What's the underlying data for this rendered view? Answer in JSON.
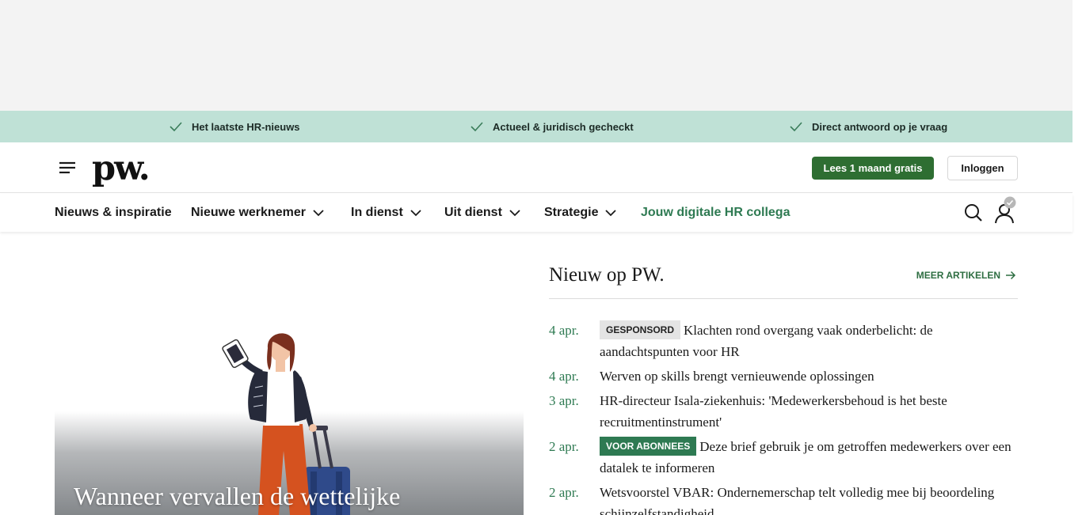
{
  "usps": [
    {
      "label": "Het laatste HR-nieuws"
    },
    {
      "label": "Actueel & juridisch gecheckt"
    },
    {
      "label": "Direct antwoord op je vraag"
    }
  ],
  "header": {
    "logo": "pw.",
    "trial_button": "Lees 1 maand gratis",
    "login_button": "Inloggen"
  },
  "nav": {
    "items": [
      {
        "label": "Nieuws & inspiratie"
      },
      {
        "label": "Nieuwe werknemer"
      },
      {
        "label": "In dienst"
      },
      {
        "label": "Uit dienst"
      },
      {
        "label": "Strategie"
      },
      {
        "label": "Jouw digitale HR collega"
      }
    ]
  },
  "hero": {
    "title": "Wanneer vervallen de wettelijke"
  },
  "news": {
    "title": "Nieuw op PW.",
    "more_label": "MEER ARTIKELEN",
    "items": [
      {
        "date": "4 apr.",
        "badge": "GESPONSORD",
        "headline": "Klachten rond overgang vaak onderbelicht: de aandachtspunten voor HR"
      },
      {
        "date": "4 apr.",
        "badge": "",
        "headline": "Werven op skills brengt vernieuwende oplossingen"
      },
      {
        "date": "3 apr.",
        "badge": "",
        "headline": "HR-directeur Isala-ziekenhuis: 'Medewerkersbehoud is het beste recruitmentinstrument'"
      },
      {
        "date": "2 apr.",
        "badge": "VOOR ABONNEES",
        "headline": "Deze brief gebruik je om getroffen medewerkers over een datalek te informeren"
      },
      {
        "date": "2 apr.",
        "badge": "",
        "headline": "Wetsvoorstel VBAR: Ondernemerschap telt volledig mee bij beoordeling schijnzelfstandigheid"
      }
    ]
  },
  "colors": {
    "usp_background": "#bfe1d6",
    "brand_green": "#2e6e32",
    "accent_green": "#2e7a52"
  }
}
